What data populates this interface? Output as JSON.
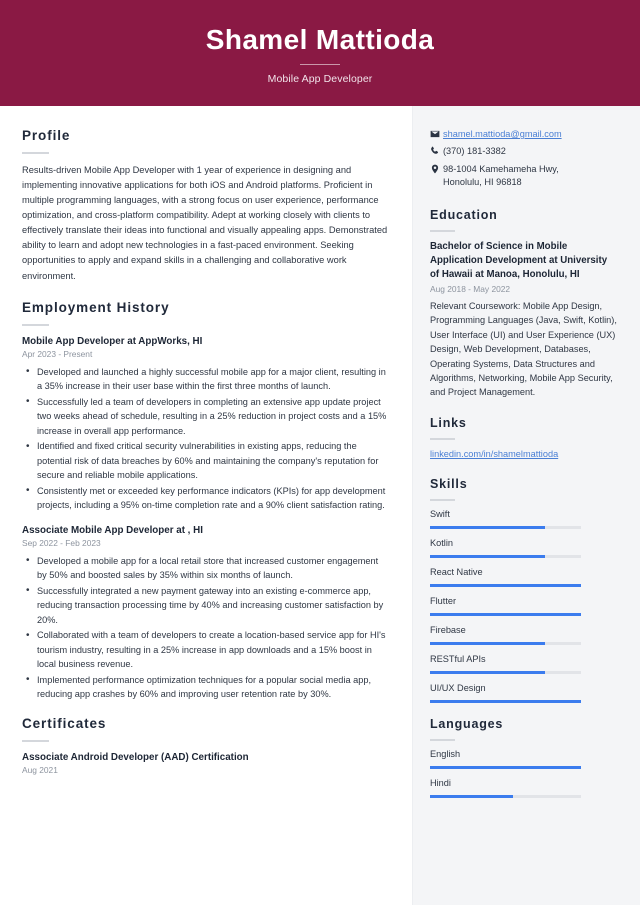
{
  "header": {
    "name": "Shamel Mattioda",
    "job_title": "Mobile App Developer",
    "background_color": "#8a1944"
  },
  "theme": {
    "accent_bar_color": "#3b7cee",
    "sidebar_bg": "#f4f5f7",
    "link_color": "#4a7fd4",
    "heading_color": "#20293a"
  },
  "main": {
    "profile": {
      "heading": "Profile",
      "text": "Results-driven Mobile App Developer with 1 year of experience in designing and implementing innovative applications for both iOS and Android platforms. Proficient in multiple programming languages, with a strong focus on user experience, performance optimization, and cross-platform compatibility. Adept at working closely with clients to effectively translate their ideas into functional and visually appealing apps. Demonstrated ability to learn and adopt new technologies in a fast-paced environment. Seeking opportunities to apply and expand skills in a challenging and collaborative work environment."
    },
    "employment": {
      "heading": "Employment History",
      "entries": [
        {
          "title": "Mobile App Developer at AppWorks, HI",
          "date": "Apr 2023 - Present",
          "bullets": [
            "Developed and launched a highly successful mobile app for a major client, resulting in a 35% increase in their user base within the first three months of launch.",
            "Successfully led a team of developers in completing an extensive app update project two weeks ahead of schedule, resulting in a 25% reduction in project costs and a 15% increase in overall app performance.",
            "Identified and fixed critical security vulnerabilities in existing apps, reducing the potential risk of data breaches by 60% and maintaining the company's reputation for secure and reliable mobile applications.",
            "Consistently met or exceeded key performance indicators (KPIs) for app development projects, including a 95% on-time completion rate and a 90% client satisfaction rating."
          ]
        },
        {
          "title": "Associate Mobile App Developer at , HI",
          "date": "Sep 2022 - Feb 2023",
          "bullets": [
            "Developed a mobile app for a local retail store that increased customer engagement by 50% and boosted sales by 35% within six months of launch.",
            "Successfully integrated a new payment gateway into an existing e-commerce app, reducing transaction processing time by 40% and increasing customer satisfaction by 20%.",
            "Collaborated with a team of developers to create a location-based service app for HI's tourism industry, resulting in a 25% increase in app downloads and a 15% boost in local business revenue.",
            "Implemented performance optimization techniques for a popular social media app, reducing app crashes by 60% and improving user retention rate by 30%."
          ]
        }
      ]
    },
    "certificates": {
      "heading": "Certificates",
      "entries": [
        {
          "title": "Associate Android Developer (AAD) Certification",
          "date": "Aug 2021"
        }
      ]
    }
  },
  "sidebar": {
    "contact": {
      "email": "shamel.mattioda@gmail.com",
      "phone": "(370) 181-3382",
      "address_line1": "98-1004 Kamehameha Hwy,",
      "address_line2": "Honolulu, HI 96818"
    },
    "education": {
      "heading": "Education",
      "entries": [
        {
          "title": "Bachelor of Science in Mobile Application Development at University of Hawaii at Manoa, Honolulu, HI",
          "date": "Aug 2018 - May 2022",
          "description": "Relevant Coursework: Mobile App Design, Programming Languages (Java, Swift, Kotlin), User Interface (UI) and User Experience (UX) Design, Web Development, Databases, Operating Systems, Data Structures and Algorithms, Networking, Mobile App Security, and Project Management."
        }
      ]
    },
    "links": {
      "heading": "Links",
      "items": [
        {
          "label": "linkedin.com/in/shamelmattioda"
        }
      ]
    },
    "skills": {
      "heading": "Skills",
      "items": [
        {
          "label": "Swift",
          "level": 76
        },
        {
          "label": "Kotlin",
          "level": 76
        },
        {
          "label": "React Native",
          "level": 100
        },
        {
          "label": "Flutter",
          "level": 100
        },
        {
          "label": "Firebase",
          "level": 76
        },
        {
          "label": "RESTful APIs",
          "level": 76
        },
        {
          "label": "UI/UX Design",
          "level": 100
        }
      ]
    },
    "languages": {
      "heading": "Languages",
      "items": [
        {
          "label": "English",
          "level": 100
        },
        {
          "label": "Hindi",
          "level": 55
        }
      ]
    }
  }
}
